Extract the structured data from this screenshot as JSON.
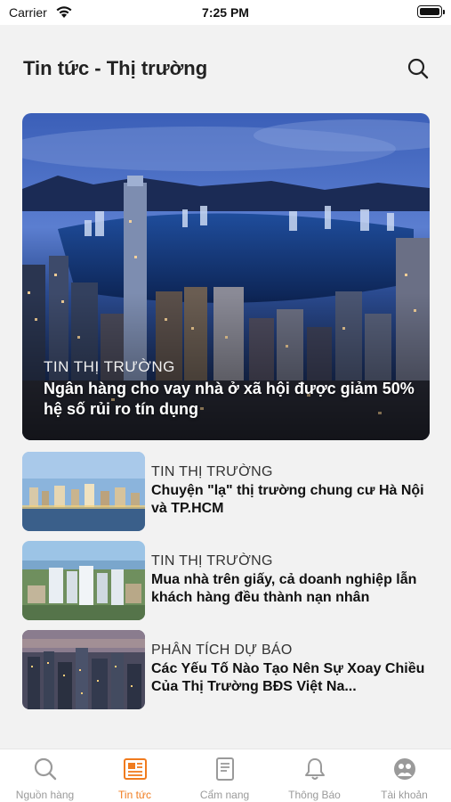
{
  "status_bar": {
    "carrier": "Carrier",
    "time": "7:25 PM"
  },
  "header": {
    "title": "Tin tức - Thị trường",
    "search_icon": "search-icon"
  },
  "featured": {
    "category": "TIN THỊ TRƯỜNG",
    "title": "Ngân hàng cho vay nhà ở xã hội được giảm 50% hệ số rủi ro tín dụng"
  },
  "news": [
    {
      "category": "TIN THỊ TRƯỜNG",
      "title": "Chuyện \"lạ\" thị trường chung cư Hà Nội và TP.HCM"
    },
    {
      "category": "TIN THỊ TRƯỜNG",
      "title": "Mua nhà trên giấy, cả doanh nghiệp lẫn khách hàng đều thành nạn nhân"
    },
    {
      "category": "PHÂN TÍCH DỰ BÁO",
      "title": "Các Yếu Tố Nào Tạo Nên Sự Xoay Chiều Của Thị Trường BĐS Việt Na..."
    }
  ],
  "tabs": [
    {
      "label": "Nguồn hàng",
      "icon": "search-icon"
    },
    {
      "label": "Tin tức",
      "icon": "newspaper-icon"
    },
    {
      "label": "Cẩm nang",
      "icon": "document-icon"
    },
    {
      "label": "Thông Báo",
      "icon": "bell-icon"
    },
    {
      "label": "Tài khoản",
      "icon": "account-icon"
    }
  ],
  "colors": {
    "accent": "#f07b1e",
    "inactive": "#9a9a9a",
    "background": "#f2f2f2"
  }
}
